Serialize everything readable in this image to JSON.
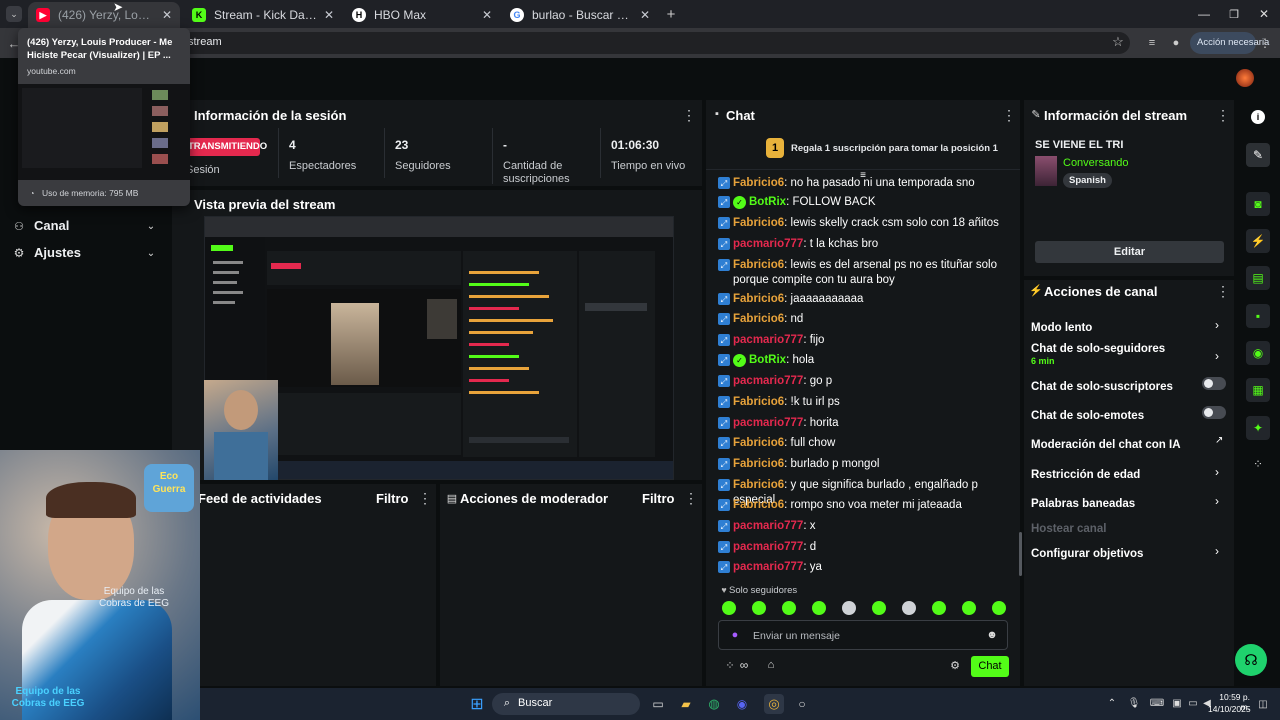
{
  "browser": {
    "tabs": [
      {
        "label": "(426) Yerzy, Louis Producer - M",
        "active": true
      },
      {
        "label": "Stream - Kick Dashboard"
      },
      {
        "label": "HBO Max"
      },
      {
        "label": "burlao - Buscar con Google"
      }
    ],
    "address_text": "stream",
    "action_label": "Acción necesaria"
  },
  "tab_preview": {
    "title": "(426) Yerzy, Louis Producer - Me Hiciste Pecar (Visualizer) | EP ...",
    "domain": "youtube.com",
    "memory": "Uso de memoria: 795 MB"
  },
  "sidebar": {
    "items": [
      {
        "label": "Canal",
        "icon": "users-icon"
      },
      {
        "label": "Ajustes",
        "icon": "gear-icon"
      }
    ]
  },
  "session": {
    "title": "Información de la sesión",
    "status": "TRANSMITIENDO",
    "status_sub": "Sesión",
    "stats": [
      {
        "value": "4",
        "label": "Espectadores"
      },
      {
        "value": "23",
        "label": "Seguidores"
      },
      {
        "value": "-",
        "label": "Cantidad de suscripciones"
      },
      {
        "value": "01:06:30",
        "label": "Tiempo en vivo"
      }
    ]
  },
  "preview": {
    "title": "Vista previa del stream"
  },
  "activity": {
    "title": "Feed de actividades",
    "filter": "Filtro"
  },
  "modactions": {
    "title": "Acciones de moderador",
    "filter": "Filtro"
  },
  "chat": {
    "title": "Chat",
    "gift_badge": "1",
    "gift_text": "Regala 1 suscripción para tomar la posición 1",
    "messages": [
      {
        "user": "Fabricio6",
        "type": "fab",
        "text": "no ha pasado ni una temporada sno"
      },
      {
        "user": "BotRix",
        "type": "bot",
        "text": "FOLLOW BACK"
      },
      {
        "user": "Fabricio6",
        "type": "fab",
        "text": "lewis skelly crack csm solo con 18 añitos"
      },
      {
        "user": "pacmario777",
        "type": "pac",
        "text": "t la kchas bro"
      },
      {
        "user": "Fabricio6",
        "type": "fab",
        "text": "lewis es del arsenal ps no es tituñar solo porque compite con tu aura boy"
      },
      {
        "user": "Fabricio6",
        "type": "fab",
        "text": "jaaaaaaaaaaa"
      },
      {
        "user": "Fabricio6",
        "type": "fab",
        "text": "nd"
      },
      {
        "user": "pacmario777",
        "type": "pac",
        "text": "fijo"
      },
      {
        "user": "BotRix",
        "type": "bot",
        "text": "hola"
      },
      {
        "user": "pacmario777",
        "type": "pac",
        "text": "go p"
      },
      {
        "user": "Fabricio6",
        "type": "fab",
        "text": "!k tu irl ps"
      },
      {
        "user": "pacmario777",
        "type": "pac",
        "text": "horita"
      },
      {
        "user": "Fabricio6",
        "type": "fab",
        "text": "full chow"
      },
      {
        "user": "Fabricio6",
        "type": "fab",
        "text": "burlado p mongol"
      },
      {
        "user": "Fabricio6",
        "type": "fab",
        "text": "y que significa burlado , engalñado p especial"
      },
      {
        "user": "Fabricio6",
        "type": "fab",
        "text": "rompo sno voa meter mi jateaada"
      },
      {
        "user": "pacmario777",
        "type": "pac",
        "text": "x"
      },
      {
        "user": "pacmario777",
        "type": "pac",
        "text": "d"
      },
      {
        "user": "pacmario777",
        "type": "pac",
        "text": "ya"
      }
    ],
    "followers_only": "Solo seguidores",
    "input_placeholder": "Enviar un mensaje",
    "send_label": "Chat"
  },
  "stream_info": {
    "title": "Información del stream",
    "stream_title": "SE VIENE EL TRI",
    "category": "Conversando",
    "language": "Spanish",
    "edit_label": "Editar"
  },
  "channel_actions": {
    "title": "Acciones de canal",
    "items": [
      {
        "label": "Modo lento",
        "control": "chevron"
      },
      {
        "label": "Chat de solo-seguidores",
        "sub": "6 min",
        "control": "chevron"
      },
      {
        "label": "Chat de solo-suscriptores",
        "control": "toggle"
      },
      {
        "label": "Chat de solo-emotes",
        "control": "toggle"
      },
      {
        "label": "Moderación del chat con IA",
        "control": "external"
      },
      {
        "label": "Restricción de edad",
        "control": "chevron"
      },
      {
        "label": "Palabras baneadas",
        "control": "chevron"
      },
      {
        "label": "Hostear canal",
        "control": "none",
        "disabled": true
      },
      {
        "label": "Configurar objetivos",
        "control": "chevron"
      }
    ]
  },
  "overlay": {
    "badge_top": "Eco",
    "badge_mid": "Guerra",
    "caption": "Equipo de las Cobras de EEG",
    "caption_bottom": "Equipo de las Cobras de EEG"
  },
  "taskbar": {
    "search_label": "Buscar",
    "time": "10:59 p. m.",
    "date": "14/10/2025"
  },
  "colors": {
    "kick_green": "#53fc18",
    "live_red": "#e4294e",
    "panel": "#141719",
    "bg": "#0b0e0f"
  }
}
